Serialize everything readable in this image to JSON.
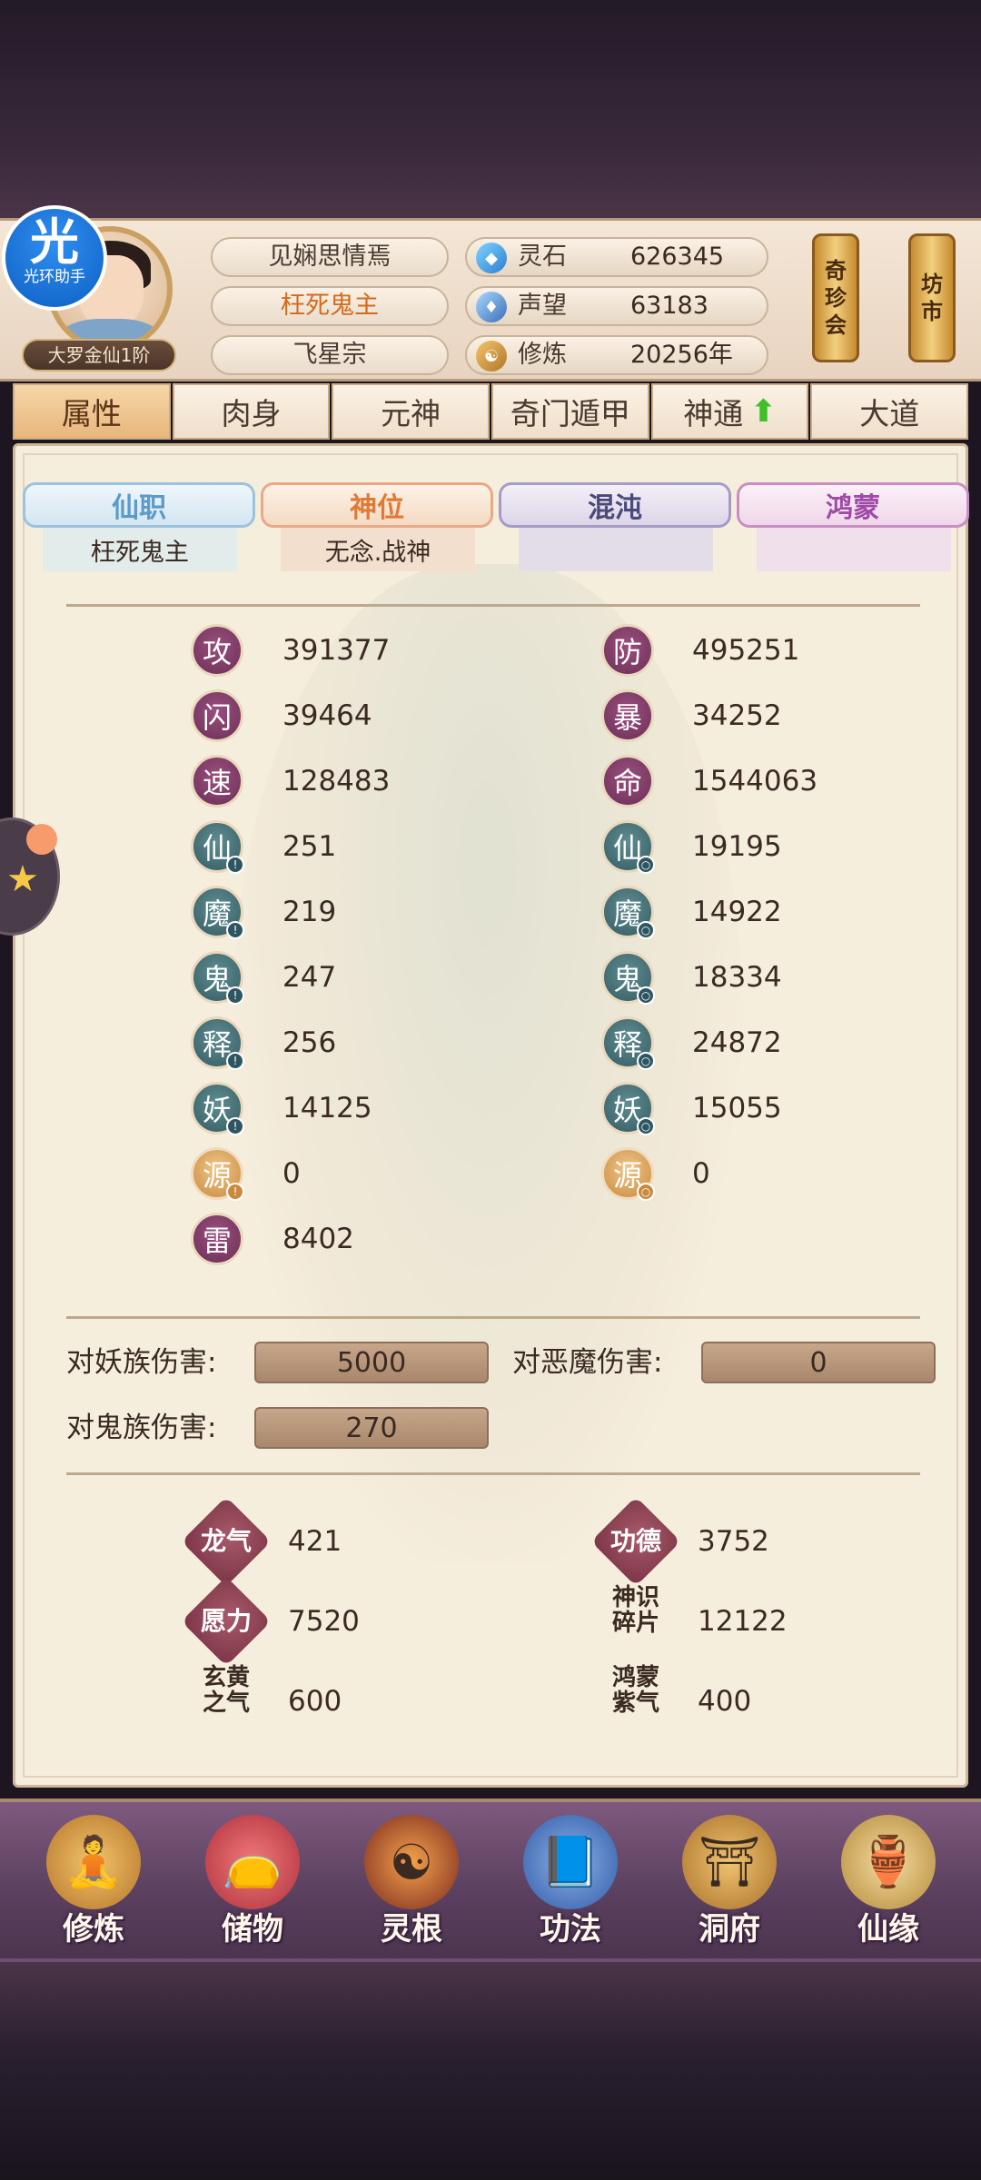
{
  "helper": {
    "icon_text": "光",
    "label": "光环助手"
  },
  "player": {
    "rank": "大罗金仙1阶",
    "name": "见娴思情焉",
    "title": "枉死鬼主",
    "sect": "飞星宗"
  },
  "resources": [
    {
      "icon": "spirit-stone-icon",
      "label": "灵石",
      "value": "626345"
    },
    {
      "icon": "reputation-icon",
      "label": "声望",
      "value": "63183"
    },
    {
      "icon": "cultivation-icon",
      "label": "修炼",
      "value": "20256年"
    }
  ],
  "shops": [
    {
      "label": "奇珍会",
      "chars": [
        "奇",
        "珍",
        "会"
      ]
    },
    {
      "label": "坊市",
      "chars": [
        "坊",
        "市"
      ]
    }
  ],
  "tabs": [
    "属性",
    "肉身",
    "元神",
    "奇门遁甲",
    "神通",
    "大道"
  ],
  "sub_tabs": [
    {
      "label": "仙职",
      "value": "枉死鬼主",
      "color": "#5b9bc9"
    },
    {
      "label": "神位",
      "value": "无念.战神",
      "color": "#e07a36"
    },
    {
      "label": "混沌",
      "value": "",
      "color": "#4a4a7a"
    },
    {
      "label": "鸿蒙",
      "value": "",
      "color": "#a04aa8"
    }
  ],
  "stats_left": [
    {
      "icon": "攻",
      "value": "391377"
    },
    {
      "icon": "闪",
      "value": "39464"
    },
    {
      "icon": "速",
      "value": "128483"
    },
    {
      "icon": "仙",
      "value": "251"
    },
    {
      "icon": "魔",
      "value": "219"
    },
    {
      "icon": "鬼",
      "value": "247"
    },
    {
      "icon": "释",
      "value": "256"
    },
    {
      "icon": "妖",
      "value": "14125"
    },
    {
      "icon": "源",
      "value": "0"
    },
    {
      "icon": "雷",
      "value": "8402"
    }
  ],
  "stats_right": [
    {
      "icon": "防",
      "value": "495251"
    },
    {
      "icon": "暴",
      "value": "34252"
    },
    {
      "icon": "命",
      "value": "1544063"
    },
    {
      "icon": "仙",
      "value": "19195"
    },
    {
      "icon": "魔",
      "value": "14922"
    },
    {
      "icon": "鬼",
      "value": "18334"
    },
    {
      "icon": "释",
      "value": "24872"
    },
    {
      "icon": "妖",
      "value": "15055"
    },
    {
      "icon": "源",
      "value": "0"
    }
  ],
  "damage": [
    {
      "label": "对妖族伤害:",
      "value": "5000"
    },
    {
      "label": "对恶魔伤害:",
      "value": "0"
    },
    {
      "label": "对鬼族伤害:",
      "value": "270"
    }
  ],
  "misc": [
    {
      "label": "龙气",
      "value": "421"
    },
    {
      "label": "功德",
      "value": "3752"
    },
    {
      "label": "愿力",
      "value": "7520"
    },
    {
      "label": "神识碎片",
      "value": "12122"
    },
    {
      "label": "玄黄之气",
      "value": "600"
    },
    {
      "label": "鸿蒙紫气",
      "value": "400"
    }
  ],
  "menu": [
    {
      "label": "修炼",
      "icon": "monk-icon"
    },
    {
      "label": "储物",
      "icon": "bag-icon"
    },
    {
      "label": "灵根",
      "icon": "spirit-root-icon"
    },
    {
      "label": "功法",
      "icon": "book-icon"
    },
    {
      "label": "洞府",
      "icon": "cave-icon"
    },
    {
      "label": "仙缘",
      "icon": "gourd-icon"
    }
  ]
}
